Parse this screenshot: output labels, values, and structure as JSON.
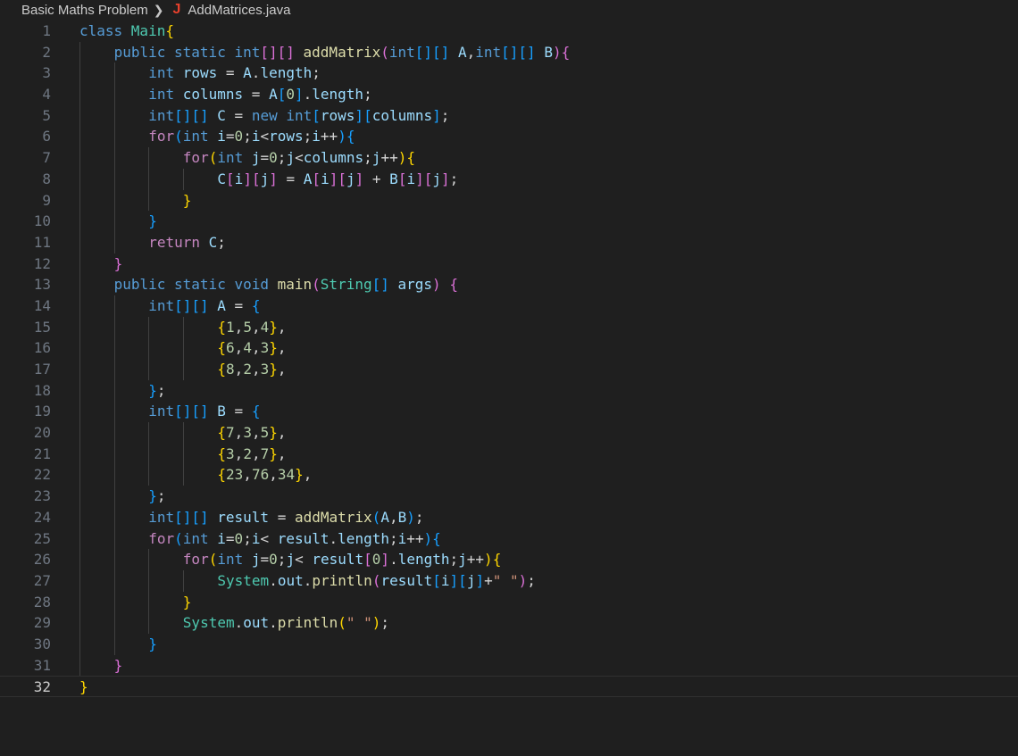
{
  "breadcrumb": {
    "folder": "Basic Maths Problem",
    "file_icon": "J",
    "file_icon_name": "java-file-icon",
    "file": "AddMatrices.java"
  },
  "editor": {
    "current_line": 32,
    "lines": [
      {
        "n": "1",
        "indent": 0,
        "tokens": [
          [
            "kw",
            "class "
          ],
          [
            "type",
            "Main"
          ],
          [
            "b1",
            "{"
          ]
        ]
      },
      {
        "n": "2",
        "indent": 1,
        "tokens": [
          [
            "kw",
            "public static int"
          ],
          [
            "b2",
            "[]"
          ],
          [
            "b2",
            "[]"
          ],
          [
            "pun",
            " "
          ],
          [
            "fn",
            "addMatrix"
          ],
          [
            "b2",
            "("
          ],
          [
            "kw",
            "int"
          ],
          [
            "b3",
            "[]"
          ],
          [
            "b3",
            "[]"
          ],
          [
            "pun",
            " "
          ],
          [
            "var",
            "A"
          ],
          [
            "pun",
            ","
          ],
          [
            "kw",
            "int"
          ],
          [
            "b3",
            "[]"
          ],
          [
            "b3",
            "[]"
          ],
          [
            "pun",
            " "
          ],
          [
            "var",
            "B"
          ],
          [
            "b2",
            ")"
          ],
          [
            "b2",
            "{"
          ]
        ]
      },
      {
        "n": "3",
        "indent": 2,
        "tokens": [
          [
            "kw",
            "int "
          ],
          [
            "var",
            "rows"
          ],
          [
            "pun",
            " = "
          ],
          [
            "var",
            "A"
          ],
          [
            "pun",
            "."
          ],
          [
            "var",
            "length"
          ],
          [
            "pun",
            ";"
          ]
        ]
      },
      {
        "n": "4",
        "indent": 2,
        "tokens": [
          [
            "kw",
            "int "
          ],
          [
            "var",
            "columns"
          ],
          [
            "pun",
            " = "
          ],
          [
            "var",
            "A"
          ],
          [
            "b3",
            "["
          ],
          [
            "num",
            "0"
          ],
          [
            "b3",
            "]"
          ],
          [
            "pun",
            "."
          ],
          [
            "var",
            "length"
          ],
          [
            "pun",
            ";"
          ]
        ]
      },
      {
        "n": "5",
        "indent": 2,
        "tokens": [
          [
            "kw",
            "int"
          ],
          [
            "b3",
            "[]"
          ],
          [
            "b3",
            "[]"
          ],
          [
            "pun",
            " "
          ],
          [
            "var",
            "C"
          ],
          [
            "pun",
            " = "
          ],
          [
            "kw",
            "new int"
          ],
          [
            "b3",
            "["
          ],
          [
            "var",
            "rows"
          ],
          [
            "b3",
            "]"
          ],
          [
            "b3",
            "["
          ],
          [
            "var",
            "columns"
          ],
          [
            "b3",
            "]"
          ],
          [
            "pun",
            ";"
          ]
        ]
      },
      {
        "n": "6",
        "indent": 2,
        "tokens": [
          [
            "ctl",
            "for"
          ],
          [
            "b3",
            "("
          ],
          [
            "kw",
            "int "
          ],
          [
            "var",
            "i"
          ],
          [
            "pun",
            "="
          ],
          [
            "num",
            "0"
          ],
          [
            "pun",
            ";"
          ],
          [
            "var",
            "i"
          ],
          [
            "pun",
            "<"
          ],
          [
            "var",
            "rows"
          ],
          [
            "pun",
            ";"
          ],
          [
            "var",
            "i"
          ],
          [
            "pun",
            "++"
          ],
          [
            "b3",
            ")"
          ],
          [
            "b3",
            "{"
          ]
        ]
      },
      {
        "n": "7",
        "indent": 3,
        "tokens": [
          [
            "ctl",
            "for"
          ],
          [
            "b1",
            "("
          ],
          [
            "kw",
            "int "
          ],
          [
            "var",
            "j"
          ],
          [
            "pun",
            "="
          ],
          [
            "num",
            "0"
          ],
          [
            "pun",
            ";"
          ],
          [
            "var",
            "j"
          ],
          [
            "pun",
            "<"
          ],
          [
            "var",
            "columns"
          ],
          [
            "pun",
            ";"
          ],
          [
            "var",
            "j"
          ],
          [
            "pun",
            "++"
          ],
          [
            "b1",
            ")"
          ],
          [
            "b1",
            "{"
          ]
        ]
      },
      {
        "n": "8",
        "indent": 4,
        "tokens": [
          [
            "var",
            "C"
          ],
          [
            "b2",
            "["
          ],
          [
            "var",
            "i"
          ],
          [
            "b2",
            "]"
          ],
          [
            "b2",
            "["
          ],
          [
            "var",
            "j"
          ],
          [
            "b2",
            "]"
          ],
          [
            "pun",
            " = "
          ],
          [
            "var",
            "A"
          ],
          [
            "b2",
            "["
          ],
          [
            "var",
            "i"
          ],
          [
            "b2",
            "]"
          ],
          [
            "b2",
            "["
          ],
          [
            "var",
            "j"
          ],
          [
            "b2",
            "]"
          ],
          [
            "pun",
            " + "
          ],
          [
            "var",
            "B"
          ],
          [
            "b2",
            "["
          ],
          [
            "var",
            "i"
          ],
          [
            "b2",
            "]"
          ],
          [
            "b2",
            "["
          ],
          [
            "var",
            "j"
          ],
          [
            "b2",
            "]"
          ],
          [
            "pun",
            ";"
          ]
        ]
      },
      {
        "n": "9",
        "indent": 3,
        "tokens": [
          [
            "b1",
            "}"
          ]
        ]
      },
      {
        "n": "10",
        "indent": 2,
        "tokens": [
          [
            "b3",
            "}"
          ]
        ]
      },
      {
        "n": "11",
        "indent": 2,
        "tokens": [
          [
            "ctl",
            "return "
          ],
          [
            "var",
            "C"
          ],
          [
            "pun",
            ";"
          ]
        ]
      },
      {
        "n": "12",
        "indent": 1,
        "tokens": [
          [
            "b2",
            "}"
          ]
        ]
      },
      {
        "n": "13",
        "indent": 1,
        "tokens": [
          [
            "kw",
            "public static void "
          ],
          [
            "fn",
            "main"
          ],
          [
            "b2",
            "("
          ],
          [
            "type",
            "String"
          ],
          [
            "b3",
            "[]"
          ],
          [
            "pun",
            " "
          ],
          [
            "var",
            "args"
          ],
          [
            "b2",
            ")"
          ],
          [
            "pun",
            " "
          ],
          [
            "b2",
            "{"
          ]
        ]
      },
      {
        "n": "14",
        "indent": 2,
        "tokens": [
          [
            "kw",
            "int"
          ],
          [
            "b3",
            "[]"
          ],
          [
            "b3",
            "[]"
          ],
          [
            "pun",
            " "
          ],
          [
            "var",
            "A"
          ],
          [
            "pun",
            " = "
          ],
          [
            "b3",
            "{"
          ]
        ]
      },
      {
        "n": "15",
        "indent": 4,
        "tokens": [
          [
            "b1",
            "{"
          ],
          [
            "num",
            "1"
          ],
          [
            "pun",
            ","
          ],
          [
            "num",
            "5"
          ],
          [
            "pun",
            ","
          ],
          [
            "num",
            "4"
          ],
          [
            "b1",
            "}"
          ],
          [
            "pun",
            ","
          ]
        ]
      },
      {
        "n": "16",
        "indent": 4,
        "tokens": [
          [
            "b1",
            "{"
          ],
          [
            "num",
            "6"
          ],
          [
            "pun",
            ","
          ],
          [
            "num",
            "4"
          ],
          [
            "pun",
            ","
          ],
          [
            "num",
            "3"
          ],
          [
            "b1",
            "}"
          ],
          [
            "pun",
            ","
          ]
        ]
      },
      {
        "n": "17",
        "indent": 4,
        "tokens": [
          [
            "b1",
            "{"
          ],
          [
            "num",
            "8"
          ],
          [
            "pun",
            ","
          ],
          [
            "num",
            "2"
          ],
          [
            "pun",
            ","
          ],
          [
            "num",
            "3"
          ],
          [
            "b1",
            "}"
          ],
          [
            "pun",
            ","
          ]
        ]
      },
      {
        "n": "18",
        "indent": 2,
        "tokens": [
          [
            "b3",
            "}"
          ],
          [
            "pun",
            ";"
          ]
        ]
      },
      {
        "n": "19",
        "indent": 2,
        "tokens": [
          [
            "kw",
            "int"
          ],
          [
            "b3",
            "[]"
          ],
          [
            "b3",
            "[]"
          ],
          [
            "pun",
            " "
          ],
          [
            "var",
            "B"
          ],
          [
            "pun",
            " = "
          ],
          [
            "b3",
            "{"
          ]
        ]
      },
      {
        "n": "20",
        "indent": 4,
        "tokens": [
          [
            "b1",
            "{"
          ],
          [
            "num",
            "7"
          ],
          [
            "pun",
            ","
          ],
          [
            "num",
            "3"
          ],
          [
            "pun",
            ","
          ],
          [
            "num",
            "5"
          ],
          [
            "b1",
            "}"
          ],
          [
            "pun",
            ","
          ]
        ]
      },
      {
        "n": "21",
        "indent": 4,
        "tokens": [
          [
            "b1",
            "{"
          ],
          [
            "num",
            "3"
          ],
          [
            "pun",
            ","
          ],
          [
            "num",
            "2"
          ],
          [
            "pun",
            ","
          ],
          [
            "num",
            "7"
          ],
          [
            "b1",
            "}"
          ],
          [
            "pun",
            ","
          ]
        ]
      },
      {
        "n": "22",
        "indent": 4,
        "tokens": [
          [
            "b1",
            "{"
          ],
          [
            "num",
            "23"
          ],
          [
            "pun",
            ","
          ],
          [
            "num",
            "76"
          ],
          [
            "pun",
            ","
          ],
          [
            "num",
            "34"
          ],
          [
            "b1",
            "}"
          ],
          [
            "pun",
            ","
          ]
        ]
      },
      {
        "n": "23",
        "indent": 2,
        "tokens": [
          [
            "b3",
            "}"
          ],
          [
            "pun",
            ";"
          ]
        ]
      },
      {
        "n": "24",
        "indent": 2,
        "tokens": [
          [
            "kw",
            "int"
          ],
          [
            "b3",
            "[]"
          ],
          [
            "b3",
            "[]"
          ],
          [
            "pun",
            " "
          ],
          [
            "var",
            "result"
          ],
          [
            "pun",
            " = "
          ],
          [
            "fn",
            "addMatrix"
          ],
          [
            "b3",
            "("
          ],
          [
            "var",
            "A"
          ],
          [
            "pun",
            ","
          ],
          [
            "var",
            "B"
          ],
          [
            "b3",
            ")"
          ],
          [
            "pun",
            ";"
          ]
        ]
      },
      {
        "n": "25",
        "indent": 2,
        "tokens": [
          [
            "ctl",
            "for"
          ],
          [
            "b3",
            "("
          ],
          [
            "kw",
            "int "
          ],
          [
            "var",
            "i"
          ],
          [
            "pun",
            "="
          ],
          [
            "num",
            "0"
          ],
          [
            "pun",
            ";"
          ],
          [
            "var",
            "i"
          ],
          [
            "pun",
            "< "
          ],
          [
            "var",
            "result"
          ],
          [
            "pun",
            "."
          ],
          [
            "var",
            "length"
          ],
          [
            "pun",
            ";"
          ],
          [
            "var",
            "i"
          ],
          [
            "pun",
            "++"
          ],
          [
            "b3",
            ")"
          ],
          [
            "b3",
            "{"
          ]
        ]
      },
      {
        "n": "26",
        "indent": 3,
        "tokens": [
          [
            "ctl",
            "for"
          ],
          [
            "b1",
            "("
          ],
          [
            "kw",
            "int "
          ],
          [
            "var",
            "j"
          ],
          [
            "pun",
            "="
          ],
          [
            "num",
            "0"
          ],
          [
            "pun",
            ";"
          ],
          [
            "var",
            "j"
          ],
          [
            "pun",
            "< "
          ],
          [
            "var",
            "result"
          ],
          [
            "b2",
            "["
          ],
          [
            "num",
            "0"
          ],
          [
            "b2",
            "]"
          ],
          [
            "pun",
            "."
          ],
          [
            "var",
            "length"
          ],
          [
            "pun",
            ";"
          ],
          [
            "var",
            "j"
          ],
          [
            "pun",
            "++"
          ],
          [
            "b1",
            ")"
          ],
          [
            "b1",
            "{"
          ]
        ]
      },
      {
        "n": "27",
        "indent": 4,
        "tokens": [
          [
            "type",
            "System"
          ],
          [
            "pun",
            "."
          ],
          [
            "var",
            "out"
          ],
          [
            "pun",
            "."
          ],
          [
            "fn",
            "println"
          ],
          [
            "b2",
            "("
          ],
          [
            "var",
            "result"
          ],
          [
            "b3",
            "["
          ],
          [
            "var",
            "i"
          ],
          [
            "b3",
            "]"
          ],
          [
            "b3",
            "["
          ],
          [
            "var",
            "j"
          ],
          [
            "b3",
            "]"
          ],
          [
            "pun",
            "+"
          ],
          [
            "str",
            "\" \""
          ],
          [
            "b2",
            ")"
          ],
          [
            "pun",
            ";"
          ]
        ]
      },
      {
        "n": "28",
        "indent": 3,
        "tokens": [
          [
            "b1",
            "}"
          ]
        ]
      },
      {
        "n": "29",
        "indent": 3,
        "tokens": [
          [
            "type",
            "System"
          ],
          [
            "pun",
            "."
          ],
          [
            "var",
            "out"
          ],
          [
            "pun",
            "."
          ],
          [
            "fn",
            "println"
          ],
          [
            "b1",
            "("
          ],
          [
            "str",
            "\" \""
          ],
          [
            "b1",
            ")"
          ],
          [
            "pun",
            ";"
          ]
        ]
      },
      {
        "n": "30",
        "indent": 2,
        "tokens": [
          [
            "b3",
            "}"
          ]
        ]
      },
      {
        "n": "31",
        "indent": 1,
        "tokens": [
          [
            "b2",
            "}"
          ]
        ]
      },
      {
        "n": "32",
        "indent": 0,
        "tokens": [
          [
            "b1",
            "}"
          ]
        ]
      }
    ]
  }
}
